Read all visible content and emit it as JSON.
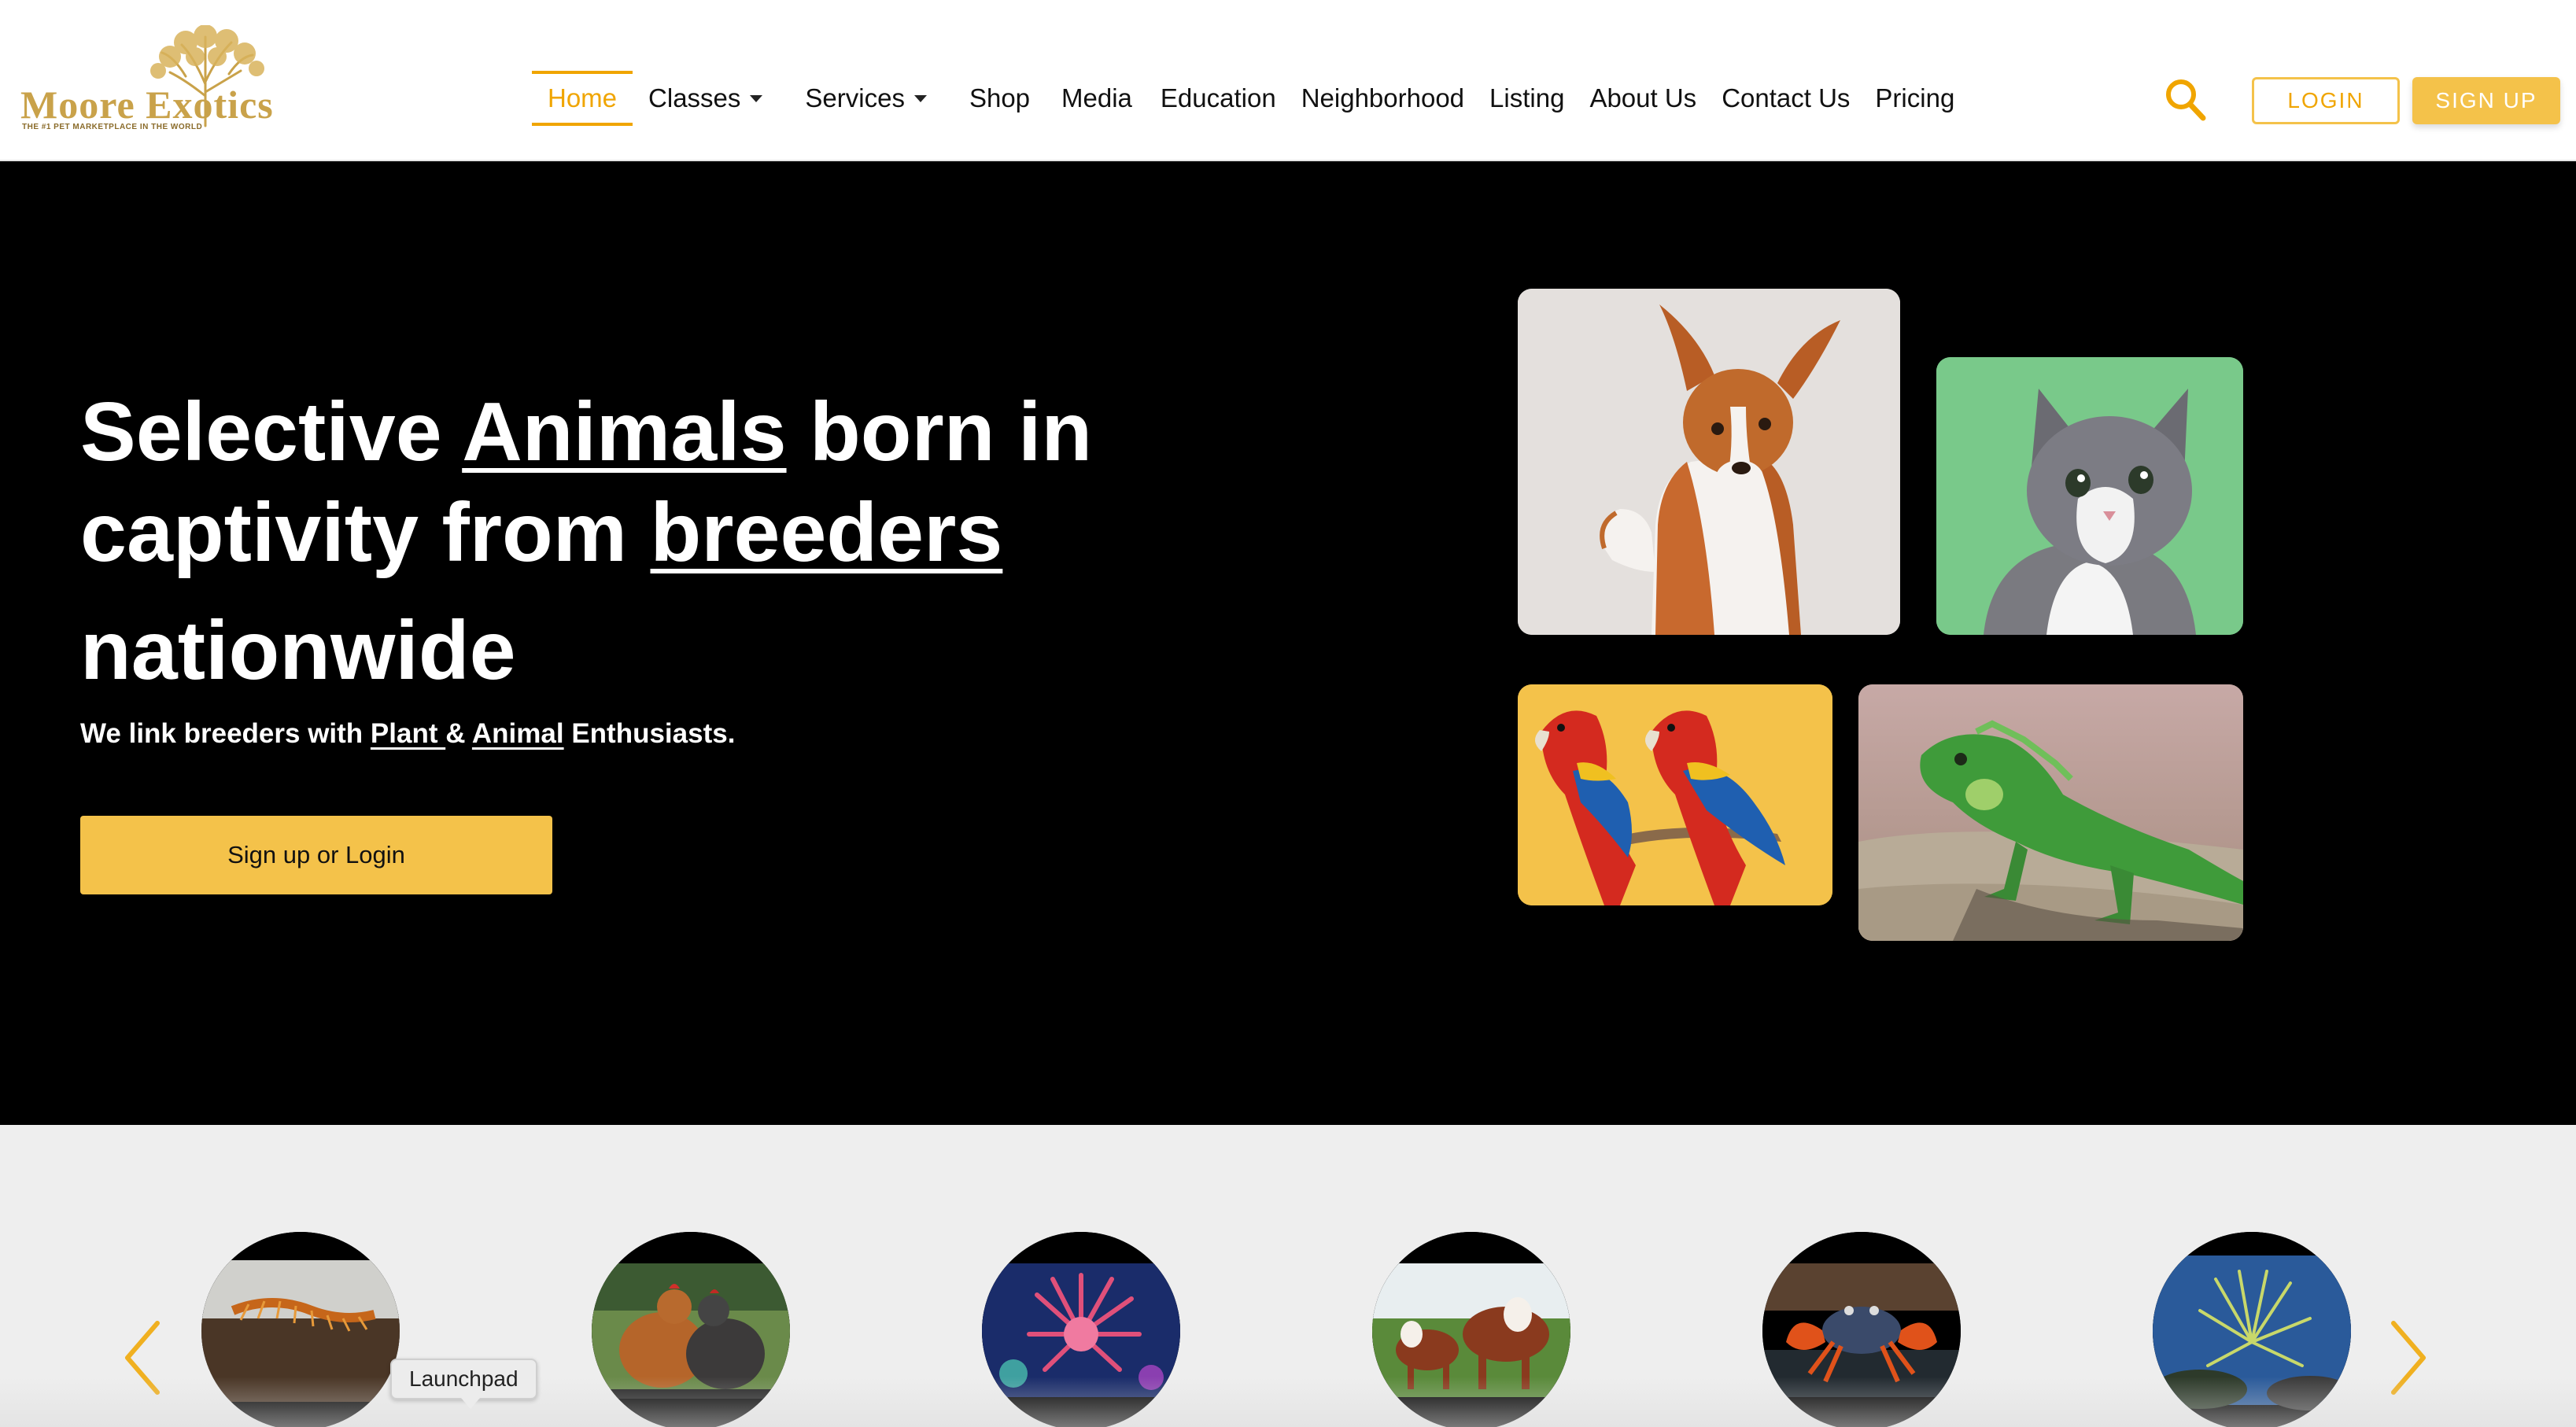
{
  "brand": {
    "name": "Moore Exotics",
    "tagline": "THE #1 PET MARKETPLACE IN THE WORLD"
  },
  "nav": {
    "items": [
      {
        "label": "Home",
        "active": true,
        "dropdown": false
      },
      {
        "label": "Classes",
        "active": false,
        "dropdown": true
      },
      {
        "label": "Services",
        "active": false,
        "dropdown": true
      },
      {
        "label": "Shop",
        "active": false,
        "dropdown": false
      },
      {
        "label": "Media",
        "active": false,
        "dropdown": false
      },
      {
        "label": "Education",
        "active": false,
        "dropdown": false
      },
      {
        "label": "Neighborhood",
        "active": false,
        "dropdown": false
      },
      {
        "label": "Listing",
        "active": false,
        "dropdown": false
      },
      {
        "label": "About Us",
        "active": false,
        "dropdown": false
      },
      {
        "label": "Contact Us",
        "active": false,
        "dropdown": false
      },
      {
        "label": "Pricing",
        "active": false,
        "dropdown": false
      }
    ],
    "login_label": "LOGIN",
    "signup_label": "SIGN UP",
    "search_icon": "search-icon"
  },
  "hero": {
    "title_part1": "Selective ",
    "title_link1": "Animals",
    "title_part2": " born in captivity from ",
    "title_link2": "breeders",
    "title_part3": "nationwide",
    "sub_part1": "We link breeders with ",
    "sub_link1": "Plant ",
    "sub_part2": "& ",
    "sub_link2": "Animal",
    "sub_part3": " Enthusiasts.",
    "cta_label": "Sign up or Login"
  },
  "carousel": {
    "prev_icon": "chevron-left-icon",
    "next_icon": "chevron-right-icon"
  },
  "tooltip": {
    "label": "Launchpad"
  },
  "colors": {
    "accent": "#f4c24a",
    "accent_text": "#f0a500",
    "hero_bg": "#000000",
    "carousel_bg": "#eeeeee"
  }
}
